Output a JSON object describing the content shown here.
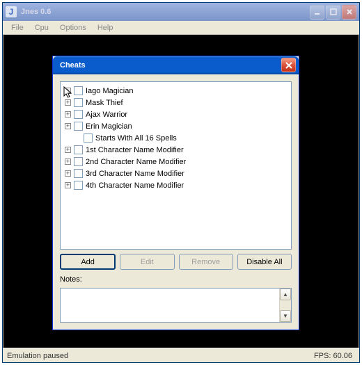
{
  "app": {
    "title": "Jnes 0.6",
    "icon_letter": "J",
    "menu": [
      "File",
      "Cpu",
      "Options",
      "Help"
    ]
  },
  "status": {
    "left": "Emulation paused",
    "right": "FPS: 60.06"
  },
  "dialog": {
    "title": "Cheats",
    "buttons": {
      "add": "Add",
      "edit": "Edit",
      "remove": "Remove",
      "disable_all": "Disable All"
    },
    "notes_label": "Notes:",
    "notes_value": "",
    "items": [
      {
        "label": "Iago Magician",
        "expandable": true,
        "child": false
      },
      {
        "label": "Mask Thief",
        "expandable": true,
        "child": false
      },
      {
        "label": "Ajax Warrior",
        "expandable": true,
        "child": false
      },
      {
        "label": "Erin Magician",
        "expandable": true,
        "child": false
      },
      {
        "label": "Starts With All 16 Spells",
        "expandable": false,
        "child": true
      },
      {
        "label": "1st Character Name Modifier",
        "expandable": true,
        "child": false
      },
      {
        "label": "2nd Character Name Modifier",
        "expandable": true,
        "child": false
      },
      {
        "label": "3rd Character Name Modifier",
        "expandable": true,
        "child": false
      },
      {
        "label": "4th Character Name Modifier",
        "expandable": true,
        "child": false
      }
    ]
  }
}
